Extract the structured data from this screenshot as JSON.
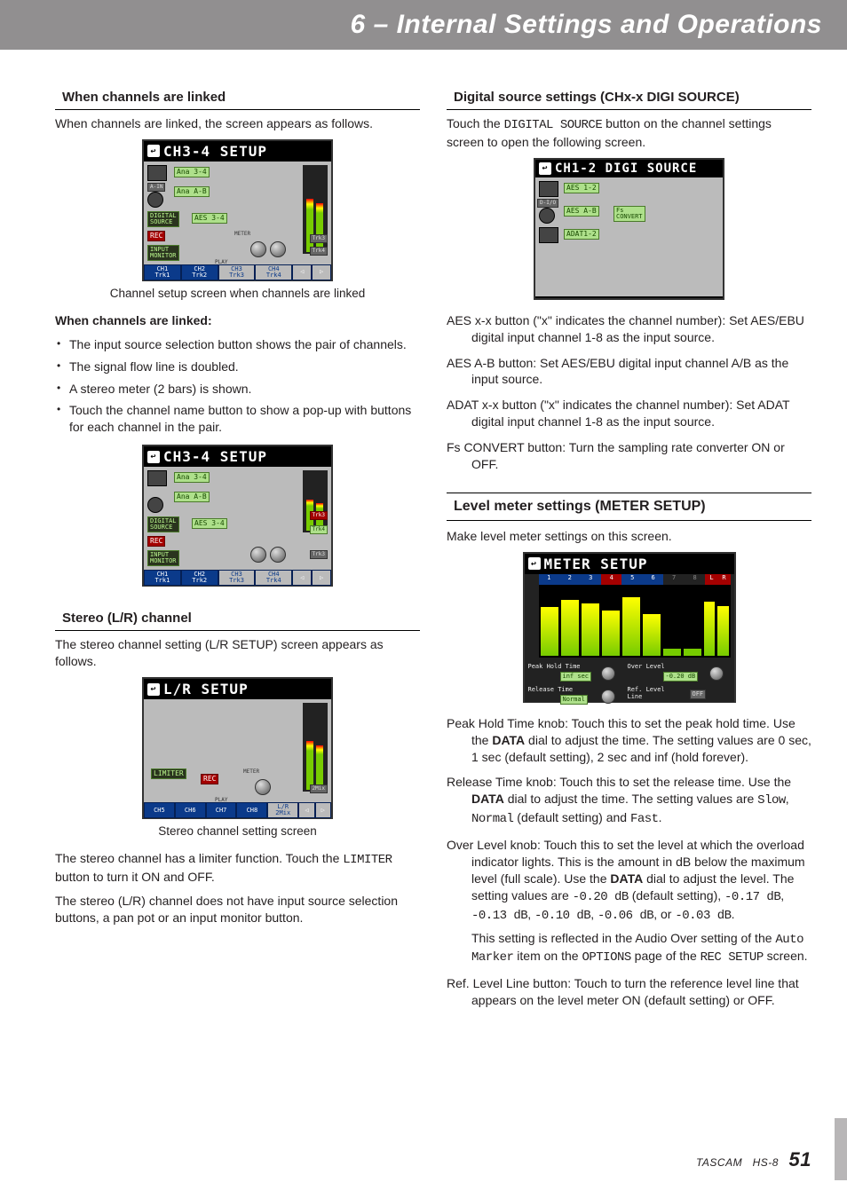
{
  "header": {
    "title": "6 – Internal Settings and Operations"
  },
  "left": {
    "h1": "When channels are linked",
    "p1": "When channels are linked, the screen appears as follows.",
    "lcd1_title": "CH3-4  SETUP",
    "caption1": "Channel setup screen when channels are linked",
    "bold1": "When channels are linked:",
    "bul1": "The input source selection button shows the pair of channels.",
    "bul2": "The signal flow line is doubled.",
    "bul3": "A stereo meter (2 bars) is shown.",
    "bul4": "Touch the channel name button to show a pop-up with buttons for each channel in the pair.",
    "lcd2_title": "CH3-4  SETUP",
    "h2": "Stereo (L/R) channel",
    "p2": "The stereo channel setting (L/R SETUP) screen appears as follows.",
    "lcd3_title": "L/R  SETUP",
    "caption2": "Stereo channel setting screen",
    "p3a": "The stereo channel has a limiter function. Touch the ",
    "p3_mono": "LIMITER",
    "p3b": " button to turn it ON and OFF.",
    "p4": "The stereo (L/R) channel does not have input source selection buttons, a pan pot or an input monitor button."
  },
  "right": {
    "h1": "Digital source settings (CHx-x DIGI SOURCE)",
    "p1a": "Touch the ",
    "p1_mono": "DIGITAL SOURCE",
    "p1b": " button on the channel settings screen to open the following screen.",
    "lcd1_title": "CH1-2  DIGI  SOURCE",
    "hang1": "AES x-x button (\"x\" indicates the channel number): Set AES/EBU digital input channel 1-8 as the input source.",
    "hang2": "AES A-B button: Set AES/EBU digital input channel A/B as the input source.",
    "hang3": "ADAT x-x button (\"x\" indicates the channel number): Set ADAT digital input channel 1-8 as the input source.",
    "hang4": "Fs CONVERT button: Turn the sampling rate converter ON or OFF.",
    "h2": "Level meter settings (METER SETUP)",
    "p2": "Make level meter settings on this screen.",
    "lcd2_title": "METER  SETUP",
    "hang5a": "Peak Hold Time knob: Touch this to set the peak hold time. Use the ",
    "hang5_bold": "DATA",
    "hang5b": " dial to adjust the time. The setting values are 0 sec, 1 sec (default setting), 2 sec and inf (hold forever).",
    "hang6a": "Release Time knob: Touch this to set the release time. Use the ",
    "hang6_bold": "DATA",
    "hang6b": " dial to adjust the time. The setting values are ",
    "hang6_m1": "Slow",
    "hang6c": ", ",
    "hang6_m2": "Normal",
    "hang6d": " (default setting) and ",
    "hang6_m3": "Fast",
    "hang6e": ".",
    "hang7a": "Over Level knob: Touch this to set the level at which the overload indicator lights. This is the amount in dB below the maximum level (full scale). Use the ",
    "hang7_bold": "DATA",
    "hang7b": " dial to adjust the level. The setting values are ",
    "hang7_m1": "-0.20 dB",
    "hang7c": " (default setting), ",
    "hang7_m2": "-0.17 dB",
    "hang7d": ", ",
    "hang7_m3": "-0.13 dB",
    "hang7e": ", ",
    "hang7_m4": "-0.10 dB",
    "hang7f": ", ",
    "hang7_m5": "-0.06 dB",
    "hang7g": ", or ",
    "hang7_m6": "-0.03 dB",
    "hang7h": ".",
    "hang7_sub_a": "This setting is reflected in the Audio Over setting of the ",
    "hang7_sub_m1": "Auto Marker",
    "hang7_sub_b": " item on the ",
    "hang7_sub_m2": "OPTIONS",
    "hang7_sub_c": " page of the ",
    "hang7_sub_m3": "REC SETUP",
    "hang7_sub_d": " screen.",
    "hang8": "Ref. Level Line button: Touch to turn the reference level line that appears on the level meter ON (default setting) or OFF."
  },
  "lcd": {
    "ana34": "Ana 3-4",
    "anaAB": "Ana A-B",
    "aes34": "AES 3-4",
    "digsrc": "DIGITAL\nSOURCE",
    "rec": "REC",
    "inpmon": "INPUT\nMONITOR",
    "meter": "METER",
    "play": "PLAY",
    "ch1": "CH1",
    "ch2": "CH2",
    "ch3": "CH3",
    "ch4": "CH4",
    "trk1": "Trk1",
    "trk2": "Trk2",
    "trk3": "Trk3",
    "trk4": "Trk4",
    "ain": "A-IN",
    "ch5": "CH5",
    "ch6": "CH6",
    "ch7": "CH7",
    "ch8": "CH8",
    "lr": "L/R",
    "mix": "2Mix",
    "limiter": "LIMITER",
    "aes12": "AES 1-2",
    "aesAB": "AES A-B",
    "adat12": "ADAT1-2",
    "fsconv": "Fs\nCONVERT",
    "dio": "D-I/O",
    "pht": "Peak Hold Time",
    "inf": "inf sec",
    "rt": "Release Time",
    "normal": "Normal",
    "ov": "Over Level",
    "ovv": "-0.20 dB",
    "rl": "Ref. Level\nLine",
    "off": "OFF",
    "m1": "1",
    "m2": "2",
    "m3": "3",
    "m4": "4",
    "m5": "5",
    "m6": "6",
    "m7": "7",
    "m8": "8",
    "mL": "L",
    "mR": "R"
  },
  "footer": {
    "brand": "TASCAM",
    "model": "HS-8",
    "page": "51"
  }
}
